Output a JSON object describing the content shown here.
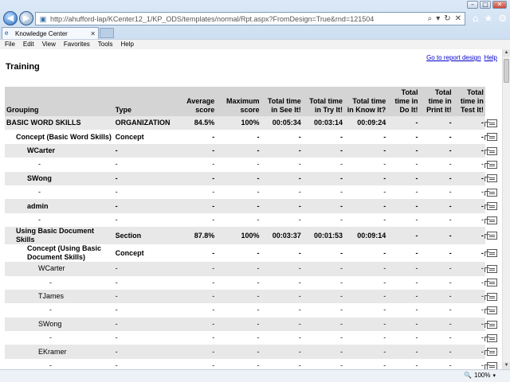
{
  "browser": {
    "url": "http://ahufford-lap/KCenter12_1/KP_ODS/templates/normal/Rpt.aspx?FromDesign=True&rnd=121504",
    "tab_title": "Knowledge Center",
    "menu": [
      "File",
      "Edit",
      "View",
      "Favorites",
      "Tools",
      "Help"
    ],
    "zoom": "100%"
  },
  "page": {
    "title": "Training",
    "link_design": "Go to report design",
    "link_help": "Help"
  },
  "table": {
    "headers": [
      "Grouping",
      "Type",
      "Average score",
      "Maximum score",
      "Total time in See It!",
      "Total time in Try It!",
      "Total time in Know It?",
      "Total time in Do It!",
      "Total time in Print It!",
      "Total time in Test It!"
    ],
    "rows": [
      {
        "indent": 0,
        "bold": true,
        "alt": true,
        "cells": [
          "BASIC WORD SKILLS",
          "ORGANIZATION",
          "84.5%",
          "100%",
          "00:05:34",
          "00:03:14",
          "00:09:24",
          "-",
          "-",
          "-"
        ]
      },
      {
        "indent": 1,
        "bold": true,
        "alt": false,
        "cells": [
          "Concept (Basic Word Skills)",
          "Concept",
          "-",
          "-",
          "-",
          "-",
          "-",
          "-",
          "-",
          "-"
        ]
      },
      {
        "indent": 2,
        "bold": true,
        "alt": true,
        "cells": [
          "WCarter",
          "-",
          "-",
          "-",
          "-",
          "-",
          "-",
          "-",
          "-",
          "-"
        ]
      },
      {
        "indent": 3,
        "bold": false,
        "alt": false,
        "cells": [
          "-",
          "-",
          "-",
          "-",
          "-",
          "-",
          "-",
          "-",
          "-",
          "-"
        ]
      },
      {
        "indent": 2,
        "bold": true,
        "alt": true,
        "cells": [
          "SWong",
          "-",
          "-",
          "-",
          "-",
          "-",
          "-",
          "-",
          "-",
          "-"
        ]
      },
      {
        "indent": 3,
        "bold": false,
        "alt": false,
        "cells": [
          "-",
          "-",
          "-",
          "-",
          "-",
          "-",
          "-",
          "-",
          "-",
          "-"
        ]
      },
      {
        "indent": 2,
        "bold": true,
        "alt": true,
        "cells": [
          "admin",
          "-",
          "-",
          "-",
          "-",
          "-",
          "-",
          "-",
          "-",
          "-"
        ]
      },
      {
        "indent": 3,
        "bold": false,
        "alt": false,
        "cells": [
          "-",
          "-",
          "-",
          "-",
          "-",
          "-",
          "-",
          "-",
          "-",
          "-"
        ]
      },
      {
        "indent": 1,
        "bold": true,
        "alt": true,
        "cells": [
          "Using Basic Document Skills",
          "Section",
          "87.8%",
          "100%",
          "00:03:37",
          "00:01:53",
          "00:09:14",
          "-",
          "-",
          "-"
        ]
      },
      {
        "indent": 2,
        "bold": true,
        "alt": false,
        "cells": [
          "Concept (Using Basic Document Skills)",
          "Concept",
          "-",
          "-",
          "-",
          "-",
          "-",
          "-",
          "-",
          "-"
        ]
      },
      {
        "indent": 3,
        "bold": false,
        "alt": true,
        "cells": [
          "WCarter",
          "-",
          "-",
          "-",
          "-",
          "-",
          "-",
          "-",
          "-",
          "-"
        ]
      },
      {
        "indent": 4,
        "bold": false,
        "alt": false,
        "cells": [
          "-",
          "-",
          "-",
          "-",
          "-",
          "-",
          "-",
          "-",
          "-",
          "-"
        ]
      },
      {
        "indent": 3,
        "bold": false,
        "alt": true,
        "cells": [
          "TJames",
          "-",
          "-",
          "-",
          "-",
          "-",
          "-",
          "-",
          "-",
          "-"
        ]
      },
      {
        "indent": 4,
        "bold": false,
        "alt": false,
        "cells": [
          "-",
          "-",
          "-",
          "-",
          "-",
          "-",
          "-",
          "-",
          "-",
          "-"
        ]
      },
      {
        "indent": 3,
        "bold": false,
        "alt": true,
        "cells": [
          "SWong",
          "-",
          "-",
          "-",
          "-",
          "-",
          "-",
          "-",
          "-",
          "-"
        ]
      },
      {
        "indent": 4,
        "bold": false,
        "alt": false,
        "cells": [
          "-",
          "-",
          "-",
          "-",
          "-",
          "-",
          "-",
          "-",
          "-",
          "-"
        ]
      },
      {
        "indent": 3,
        "bold": false,
        "alt": true,
        "cells": [
          "EKramer",
          "-",
          "-",
          "-",
          "-",
          "-",
          "-",
          "-",
          "-",
          "-"
        ]
      },
      {
        "indent": 4,
        "bold": false,
        "alt": false,
        "cells": [
          "-",
          "-",
          "-",
          "-",
          "-",
          "-",
          "-",
          "-",
          "-",
          "-"
        ]
      }
    ]
  }
}
